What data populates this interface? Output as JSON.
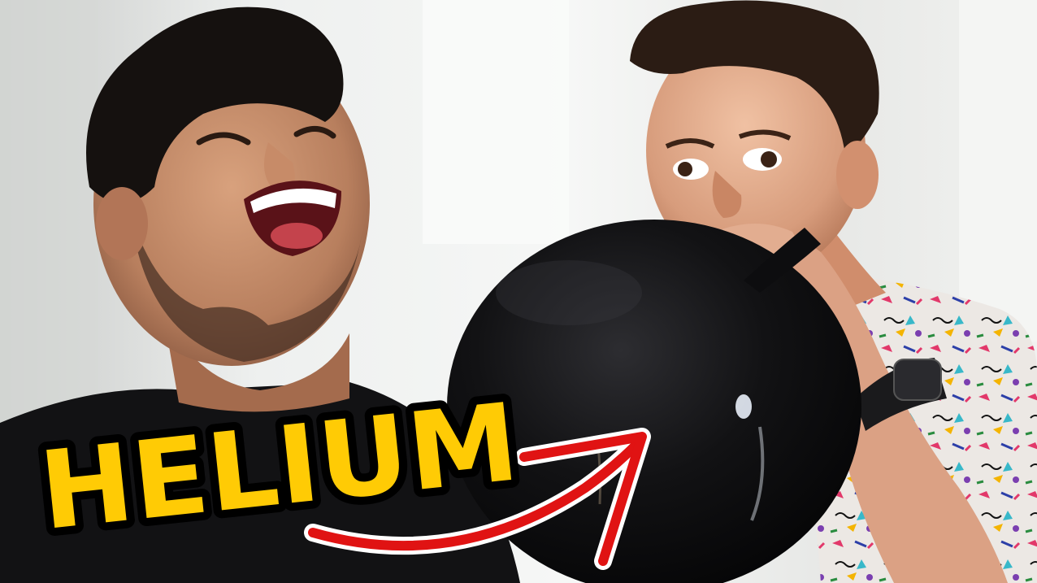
{
  "thumbnail": {
    "caption": "HELIUM",
    "colors": {
      "caption_fill": "#FFCB05",
      "caption_outline": "#000000",
      "arrow": "#E01313",
      "balloon": "#0B0B0D",
      "background": "#E6E7E6"
    },
    "subjects": [
      "laughing-man-icon",
      "man-blowing-balloon-icon",
      "black-balloon-icon",
      "red-arrow-icon"
    ]
  }
}
